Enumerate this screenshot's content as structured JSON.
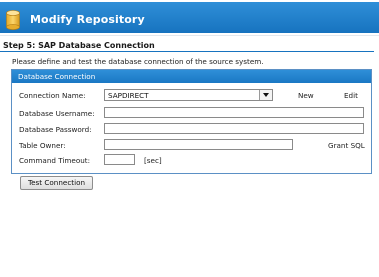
{
  "header": {
    "title": "Modify Repository"
  },
  "step": {
    "title": "Step 5:  SAP Database Connection"
  },
  "description": "Please define and test the database connection of the source system.",
  "group": {
    "title": "Database Connection",
    "connection_name": {
      "label": "Connection Name:",
      "value": "SAPDIRECT",
      "new_label": "New",
      "edit_label": "Edit"
    },
    "username": {
      "label": "Database Username:",
      "value": ""
    },
    "password": {
      "label": "Database Password:",
      "value": ""
    },
    "table_owner": {
      "label": "Table Owner:",
      "value": "",
      "grant_label": "Grant SQL"
    },
    "timeout": {
      "label": "Command Timeout:",
      "value": "",
      "unit": "[sec]"
    }
  },
  "buttons": {
    "test_connection": "Test Connection"
  },
  "colors": {
    "accent": "#1773bf",
    "header_gradient_top": "#2f8fd8"
  },
  "icons": {
    "header": "database-icon",
    "dropdown": "chevron-down-icon"
  }
}
